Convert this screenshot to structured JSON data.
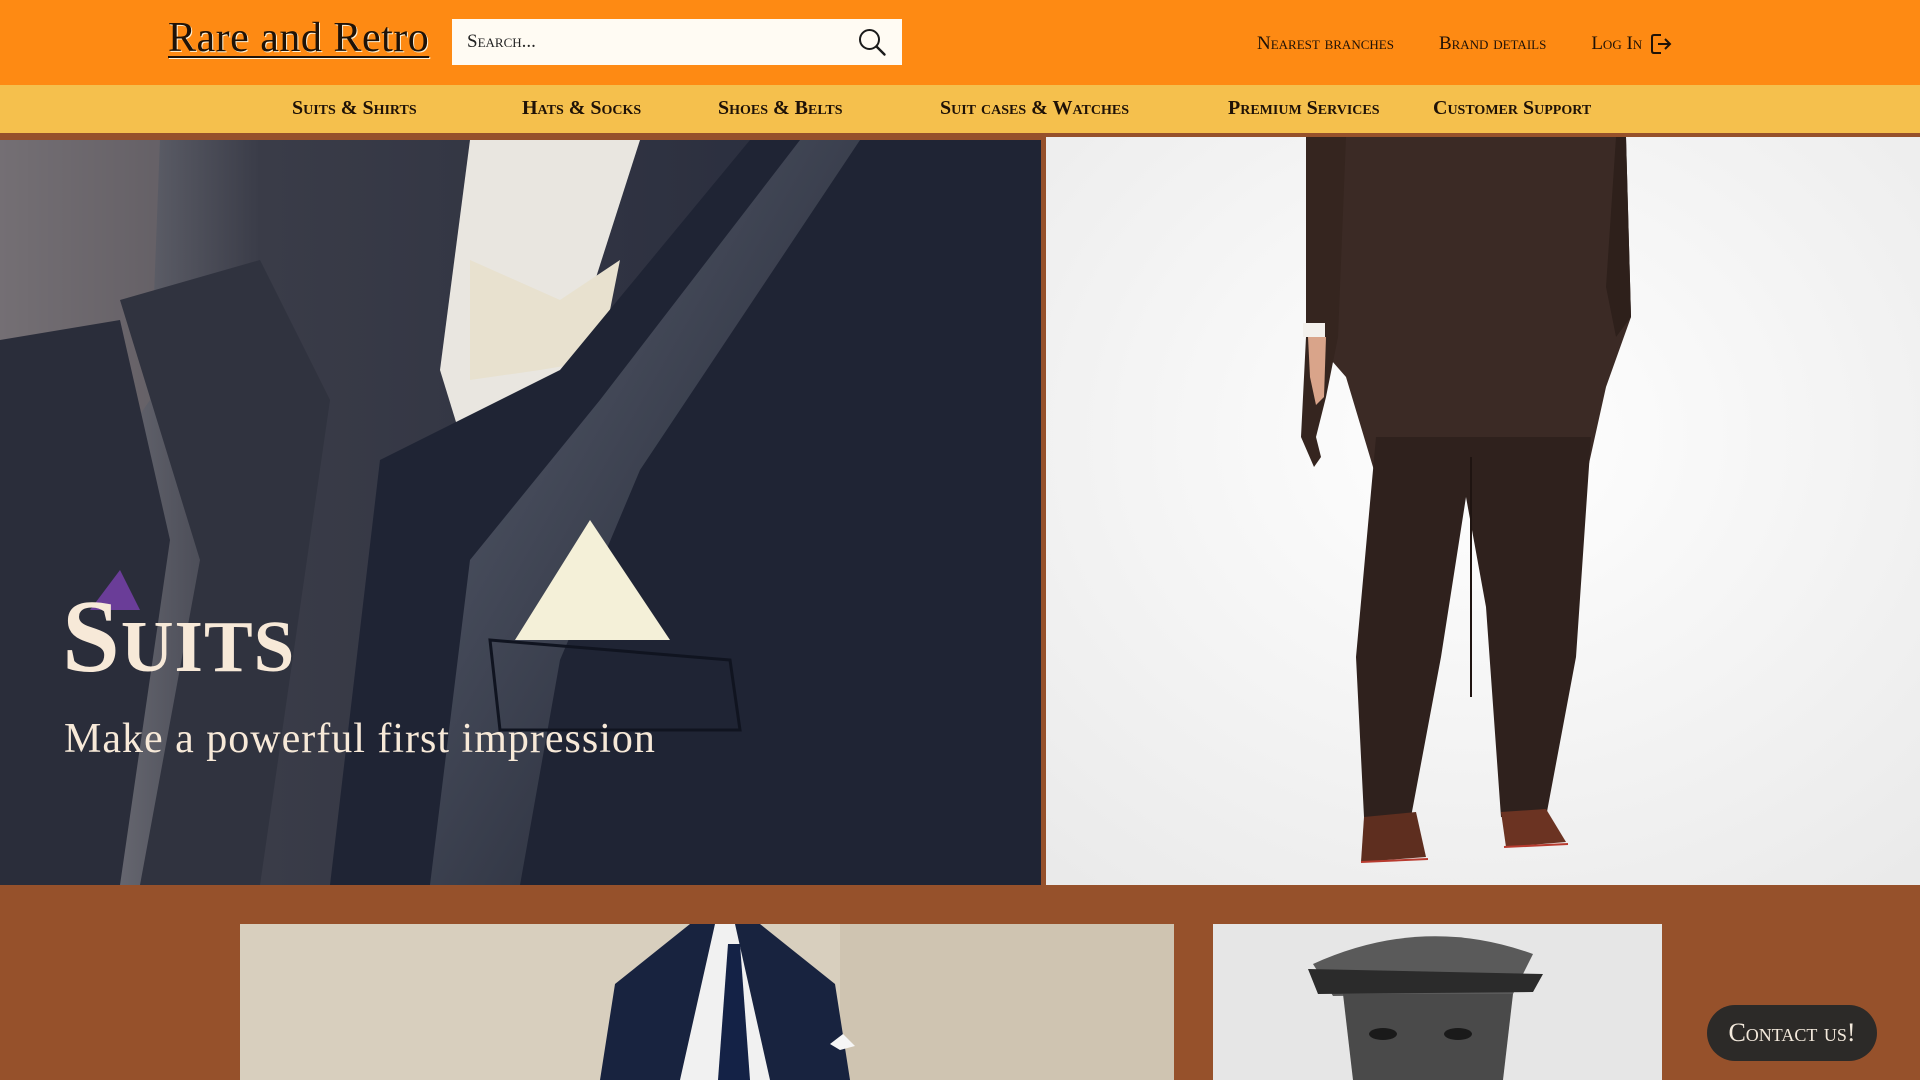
{
  "header": {
    "logo": "Rare and Retro",
    "search_placeholder": "Search...",
    "links": {
      "branches": "Nearest branches",
      "brand": "Brand details",
      "login": "Log In"
    }
  },
  "nav": {
    "items": [
      "Suits & Shirts",
      "Hats & Socks",
      "Shoes & Belts",
      "Suit cases & Watches",
      "Premium Services",
      "Customer Support"
    ]
  },
  "hero": {
    "title": "Suits",
    "subtitle": "Make a powerful first impression"
  },
  "contact": {
    "label": "Contact us!"
  },
  "colors": {
    "header_bg": "#fe8a13",
    "nav_bg": "#f5c04d",
    "page_bg": "#96512b",
    "contact_bg": "#2c2a28",
    "text_dark": "#1f1207",
    "hero_text": "#f7e9d8"
  },
  "icons": {
    "search": "search-icon",
    "login": "login-arrow-icon"
  }
}
